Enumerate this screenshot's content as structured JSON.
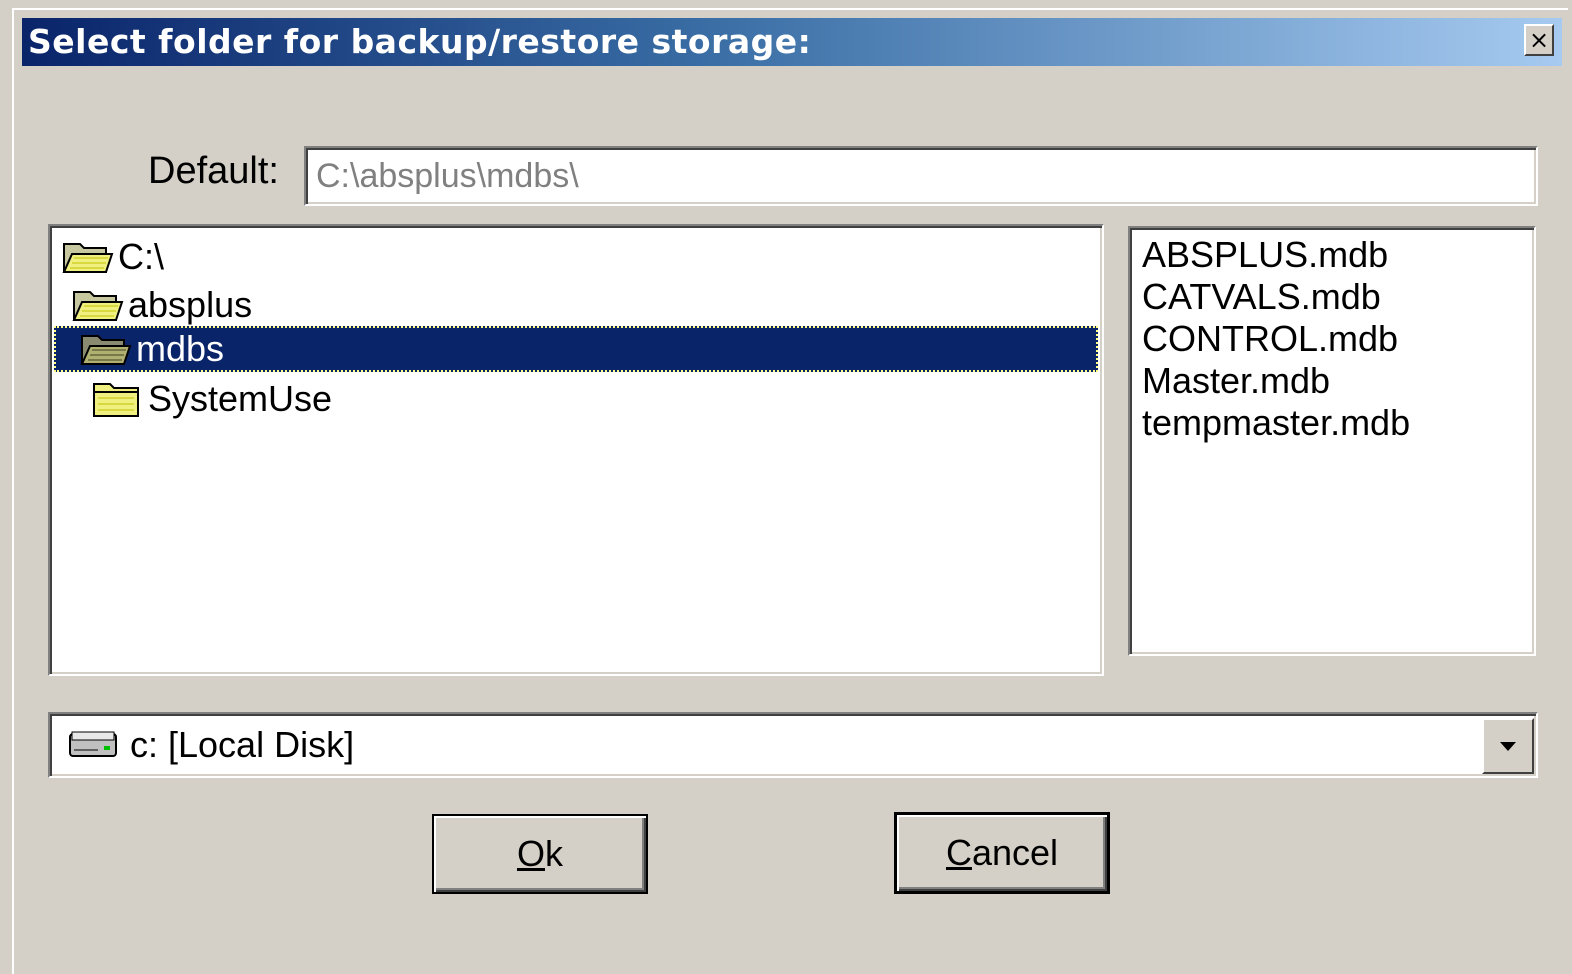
{
  "window": {
    "title": "Select folder for backup/restore storage:",
    "close_label": "×"
  },
  "default_path": {
    "label": "Default:",
    "value": "C:\\absplus\\mdbs\\"
  },
  "folder_tree": {
    "items": [
      {
        "label": "C:\\",
        "icon": "open-folder-icon",
        "selected": false
      },
      {
        "label": "absplus",
        "icon": "open-folder-icon",
        "selected": false
      },
      {
        "label": "mdbs",
        "icon": "open-folder-icon",
        "selected": true
      },
      {
        "label": "SystemUse",
        "icon": "folder-icon",
        "selected": false
      }
    ]
  },
  "file_list": {
    "items": [
      "ABSPLUS.mdb",
      "CATVALS.mdb",
      "CONTROL.mdb",
      "Master.mdb",
      "tempmaster.mdb"
    ]
  },
  "drive_select": {
    "value": "c: [Local Disk]",
    "icon": "drive-icon"
  },
  "buttons": {
    "ok_label": "Ok",
    "cancel_label": "Cancel"
  },
  "colors": {
    "selection": "#0a246a",
    "face": "#d4d0c8"
  }
}
